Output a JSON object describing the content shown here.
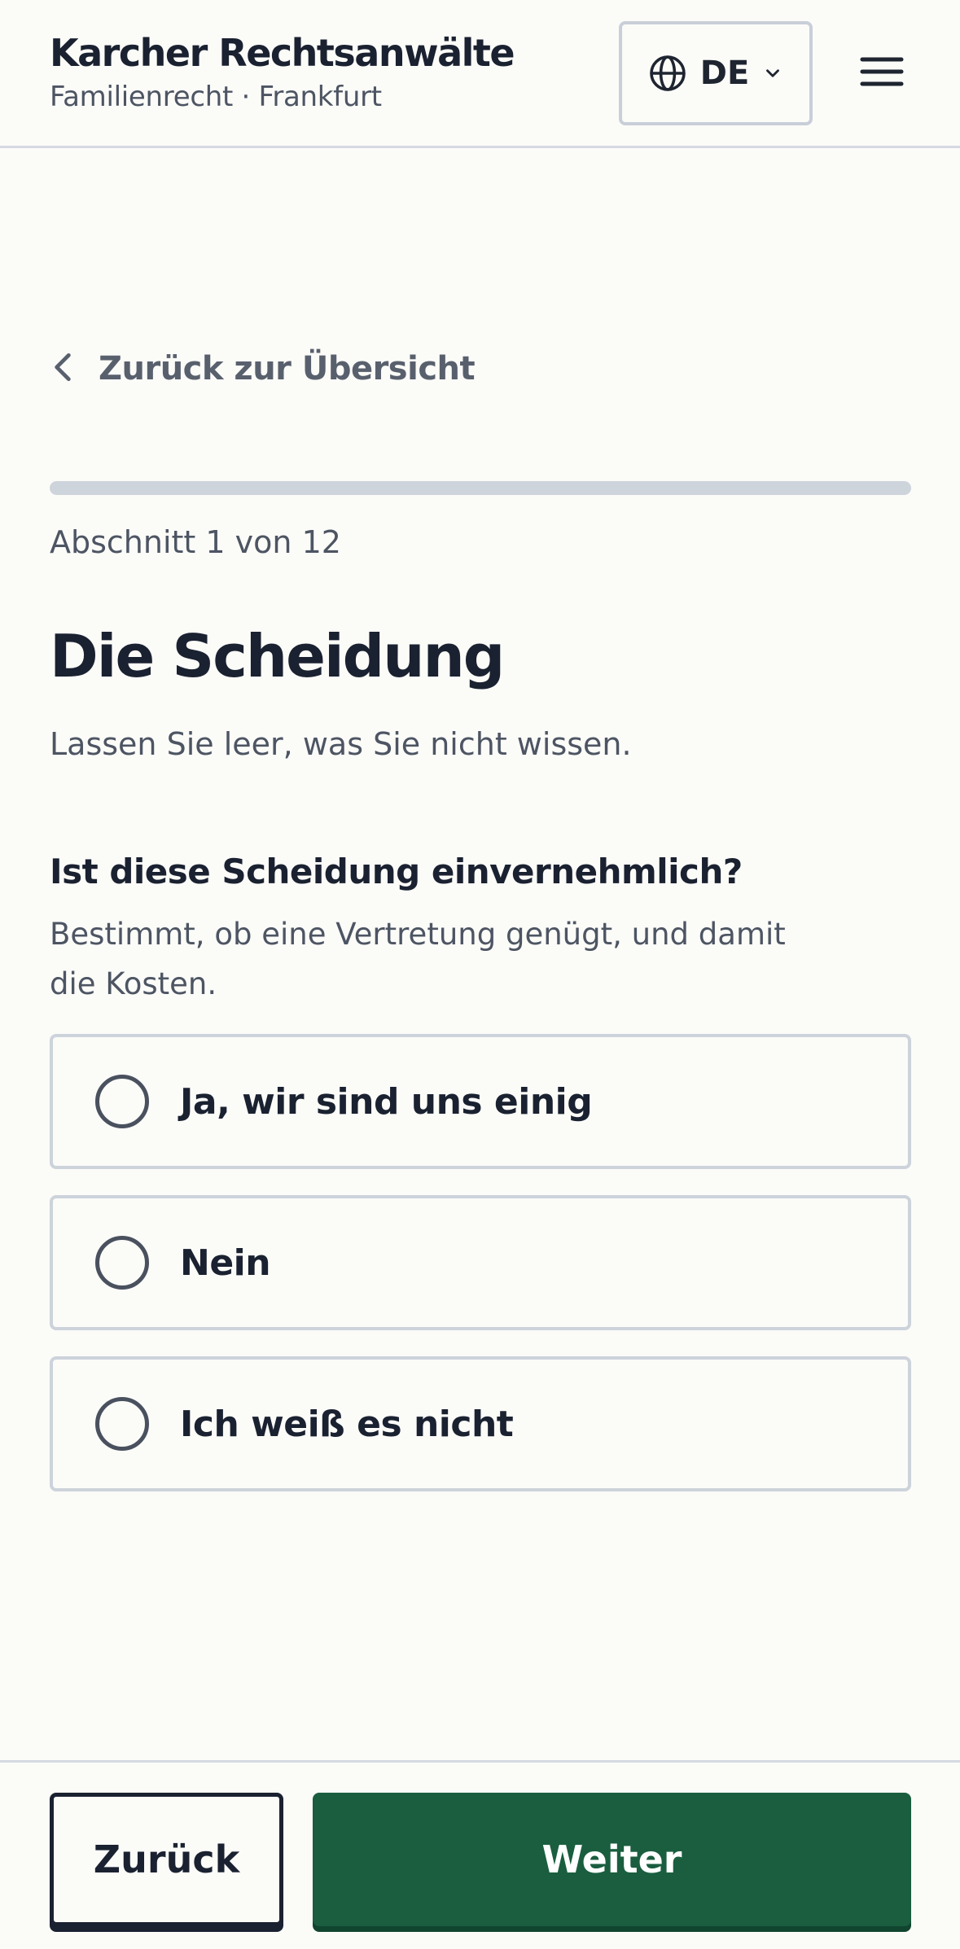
{
  "header": {
    "brand_name": "Karcher Rechtsanwälte",
    "brand_subtitle": "Familienrecht · Frankfurt",
    "language": {
      "code": "DE",
      "icon": "globe-icon",
      "dropdown_icon": "chevron-down-icon"
    },
    "menu_icon": "hamburger-menu-icon"
  },
  "nav": {
    "back_link_label": "Zurück zur Übersicht",
    "back_icon": "chevron-left-icon"
  },
  "progress": {
    "label": "Abschnitt 1 von 12",
    "current": 1,
    "total": 12,
    "fraction_filled": 0
  },
  "section": {
    "title": "Die Scheidung",
    "intro": "Lassen Sie leer, was Sie nicht wissen."
  },
  "question": {
    "label": "Ist diese Scheidung einvernehmlich?",
    "hint": "Bestimmt, ob eine Vertretung genügt, und damit die Kosten.",
    "options": [
      {
        "label": "Ja, wir sind uns einig",
        "selected": false
      },
      {
        "label": "Nein",
        "selected": false
      },
      {
        "label": "Ich weiß es nicht",
        "selected": false
      }
    ]
  },
  "footer": {
    "back_label": "Zurück",
    "next_label": "Weiter"
  },
  "colors": {
    "primary": "#1A5E3F",
    "text": "#1A2130",
    "muted_text": "#4D5563",
    "border": "#CDD3DB",
    "background": "#FBFBF8"
  }
}
